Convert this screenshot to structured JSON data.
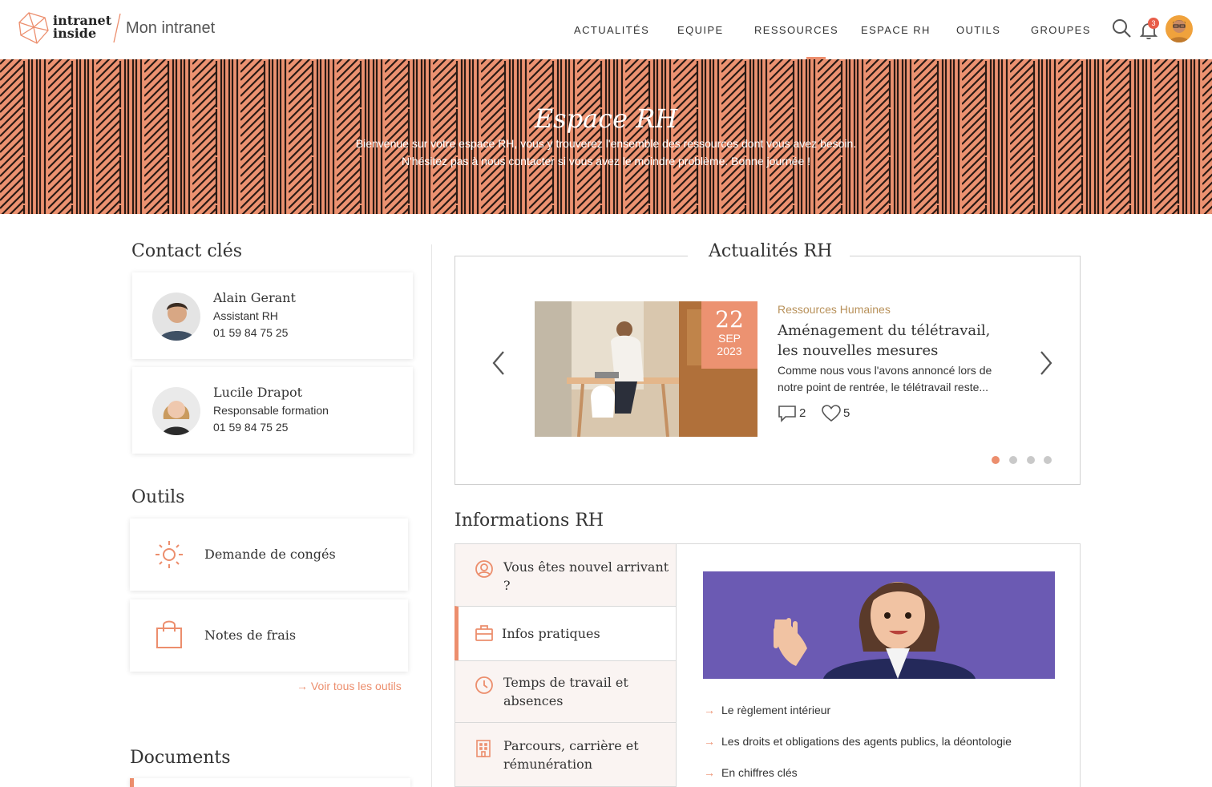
{
  "header": {
    "logo_line1": "intranet",
    "logo_line2": "inside",
    "site_name": "Mon intranet",
    "nav": [
      "ACTUALITÉS",
      "EQUIPE",
      "RESSOURCES",
      "ESPACE RH",
      "OUTILS",
      "GROUPES"
    ],
    "notification_count": "3",
    "icons": [
      "search-icon",
      "bell-icon"
    ]
  },
  "banner": {
    "title": "Espace RH",
    "line1": "Bienvenue sur votre espace RH, vous y trouverez l'ensemble des ressources dont vous avez besoin.",
    "line2": "N'hésitez pas à nous contacter si vous avez le moindre problème. Bonne journée !"
  },
  "contacts": {
    "title": "Contact clés",
    "items": [
      {
        "name": "Alain Gerant",
        "role": "Assistant RH",
        "phone": "01 59 84 75 25"
      },
      {
        "name": "Lucile Drapot",
        "role": "Responsable formation",
        "phone": "01 59 84 75 25"
      }
    ]
  },
  "tools": {
    "title": "Outils",
    "items": [
      {
        "label": "Demande de congés",
        "icon": "sun-icon"
      },
      {
        "label": "Notes de frais",
        "icon": "shopping-bag-icon"
      }
    ],
    "see_all": "Voir tous les outils"
  },
  "documents": {
    "title": "Documents"
  },
  "news": {
    "title": "Actualités RH",
    "category": "Ressources Humaines",
    "headline_line1": "Aménagement du télétravail,",
    "headline_line2": "les nouvelles mesures",
    "excerpt_line1": "Comme nous vous l'avons annoncé lors de",
    "excerpt_line2": "notre point de rentrée, le télétravail reste...",
    "date_day": "22",
    "date_month": "SEP",
    "date_year": "2023",
    "comments": "2",
    "likes": "5",
    "slides": 4,
    "active_slide": 0
  },
  "infos": {
    "title": "Informations RH",
    "tabs": [
      {
        "label_line1": "Vous êtes nouvel arrivant ?",
        "label_line2": "",
        "icon": "user-circle-icon"
      },
      {
        "label_line1": "Infos pratiques",
        "label_line2": "",
        "icon": "briefcase-icon"
      },
      {
        "label_line1": "Temps de travail et",
        "label_line2": "absences",
        "icon": "clock-icon"
      },
      {
        "label_line1": "Parcours, carrière et",
        "label_line2": "rémunération",
        "icon": "building-icon"
      }
    ],
    "active_tab": 1,
    "links": [
      "Le règlement intérieur",
      "Les droits et obligations des agents publics, la déontologie",
      "En chiffres clés"
    ]
  },
  "colors": {
    "accent": "#ec8e6d",
    "banner": "#ec9271",
    "category": "#b8915a",
    "panel_purple": "#6b5ab3"
  }
}
